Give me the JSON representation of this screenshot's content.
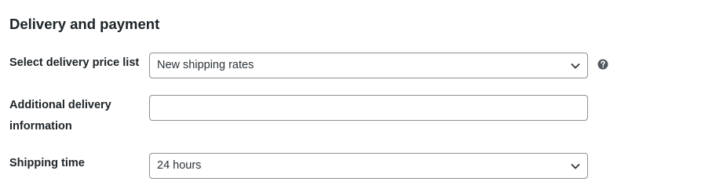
{
  "section": {
    "title": "Delivery and payment"
  },
  "delivery_price_list": {
    "label": "Select delivery price list",
    "selected": "New shipping rates",
    "help_icon": "question-circle-icon"
  },
  "additional_info": {
    "label": "Additional delivery information",
    "value": "",
    "placeholder": ""
  },
  "shipping_time": {
    "label": "Shipping time",
    "selected": "24 hours"
  },
  "colors": {
    "border": "#8c8f94",
    "text": "#1d2327",
    "icon": "#50575e"
  }
}
